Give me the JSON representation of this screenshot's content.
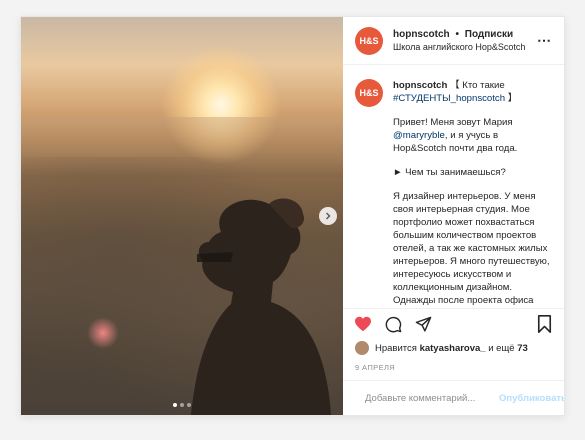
{
  "post": {
    "account": {
      "username": "hopnscotch",
      "separator": "•",
      "follow_status": "Подписки",
      "subtitle": "Школа английского Hop&Scotch",
      "avatar_text": "H&S",
      "avatar_color": "#e65a3b"
    },
    "more_icon": "⋯",
    "caption": {
      "line1_tail": " 【 Кто такие",
      "hashtag": "#СТУДЕНТЫ_hopnscotch",
      "line1_end": " 】",
      "p2_start": "Привет! Меня зовут Мария",
      "mention": "@maryryble",
      "p2_end": ", и я учусь в Hop&Scotch почти два года.",
      "p3": "► Чем ты занимаешься?",
      "p4": "Я дизайнер интерьеров. У меня своя интерьерная студия. Мое портфолио может похвастаться большим количеством проектов отелей, а так же кастомных жилых интерьеров. Я много путешествую, интересуюсь искусством и коллекционным дизайном. Однажды после проекта офиса для французской компании я поняла, что мой английский"
    },
    "likes": {
      "prefix": "Нравится",
      "user": "katyasharova_",
      "suffix": "и ещё",
      "count": "73"
    },
    "date": "9 АПРЕЛЯ",
    "comment": {
      "placeholder": "Добавьте комментарий...",
      "publish_label": "Опубликовать"
    },
    "carousel": {
      "slide_count": 3,
      "active_index": 0
    },
    "colors": {
      "like_red": "#ed4956",
      "link_blue": "#00376b",
      "publish_disabled": "#b2dffc"
    }
  }
}
